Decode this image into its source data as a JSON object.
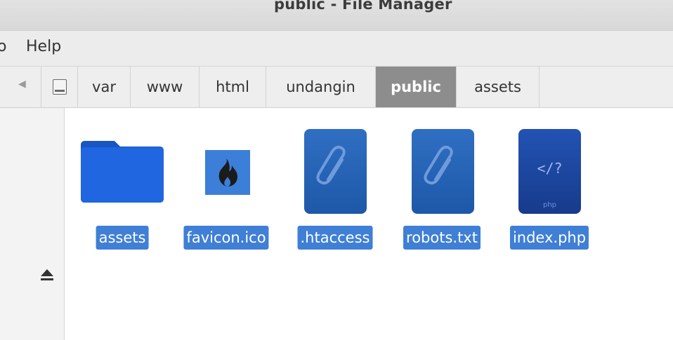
{
  "window": {
    "title": "public - File Manager"
  },
  "menubar": {
    "items": [
      {
        "label": "o"
      },
      {
        "label": "Help"
      }
    ]
  },
  "locationbar": {
    "back_icon": "chevron-left-icon",
    "drive_icon": "drive-icon",
    "crumbs": [
      {
        "label": "var",
        "active": false
      },
      {
        "label": "www",
        "active": false
      },
      {
        "label": "html",
        "active": false
      },
      {
        "label": "undangin",
        "active": false
      },
      {
        "label": "public",
        "active": true
      },
      {
        "label": "assets",
        "active": false
      }
    ]
  },
  "sidepane": {
    "eject_icon": "eject-icon"
  },
  "files": [
    {
      "name": "assets",
      "icon": "folder-icon",
      "selected": true
    },
    {
      "name": "favicon.ico",
      "icon": "codeigniter-flame-icon",
      "selected": true
    },
    {
      "name": ".htaccess",
      "icon": "attachment-file-icon",
      "selected": true
    },
    {
      "name": "robots.txt",
      "icon": "attachment-file-icon",
      "selected": true
    },
    {
      "name": "index.php",
      "icon": "php-file-icon",
      "icon_text": "</?",
      "icon_subtext": "php",
      "selected": true
    }
  ],
  "colors": {
    "selection": "#3f7fd6",
    "active_crumb": "#8d8d8d",
    "folder": "#1f63d9",
    "document": "#2a66b8"
  }
}
